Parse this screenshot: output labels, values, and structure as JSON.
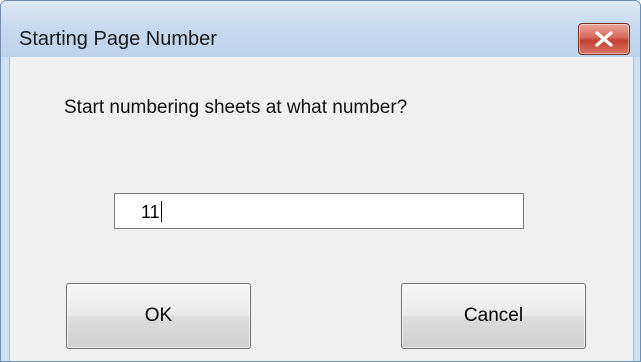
{
  "window": {
    "title": "Starting Page Number",
    "close_icon": "close-x-icon",
    "accent_color": "#c94a3a",
    "titlebar_color": "#c7daef"
  },
  "dialog": {
    "prompt": "Start numbering sheets at what number?",
    "input_value": "11",
    "ok_label": "OK",
    "cancel_label": "Cancel"
  }
}
